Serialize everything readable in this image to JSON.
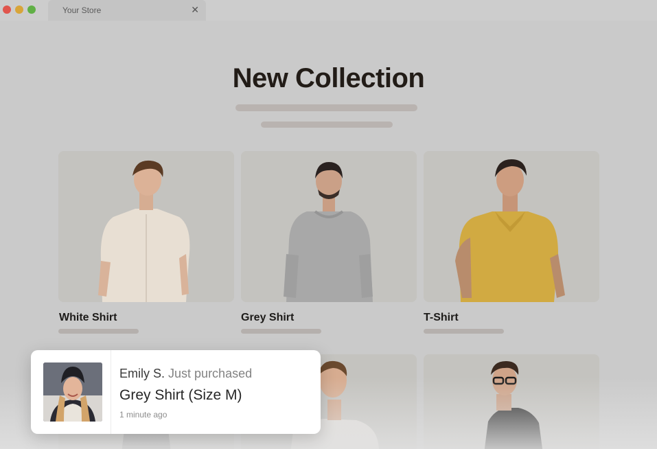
{
  "browser": {
    "tab_title": "Your Store",
    "tab_close_icon": "close-icon"
  },
  "page": {
    "heading": "New Collection",
    "products": [
      {
        "name": "White Shirt"
      },
      {
        "name": "Grey Shirt"
      },
      {
        "name": "T-Shirt"
      },
      {
        "name": ""
      },
      {
        "name": ""
      }
    ]
  },
  "notification": {
    "customer": "Emily S.",
    "action": "Just purchased",
    "product": "Grey Shirt (Size M)",
    "time": "1 minute ago"
  },
  "colors": {
    "window_dot_red": "#e0554d",
    "window_dot_yellow": "#d8a53a",
    "window_dot_green": "#61b046",
    "heading": "#221c17"
  }
}
